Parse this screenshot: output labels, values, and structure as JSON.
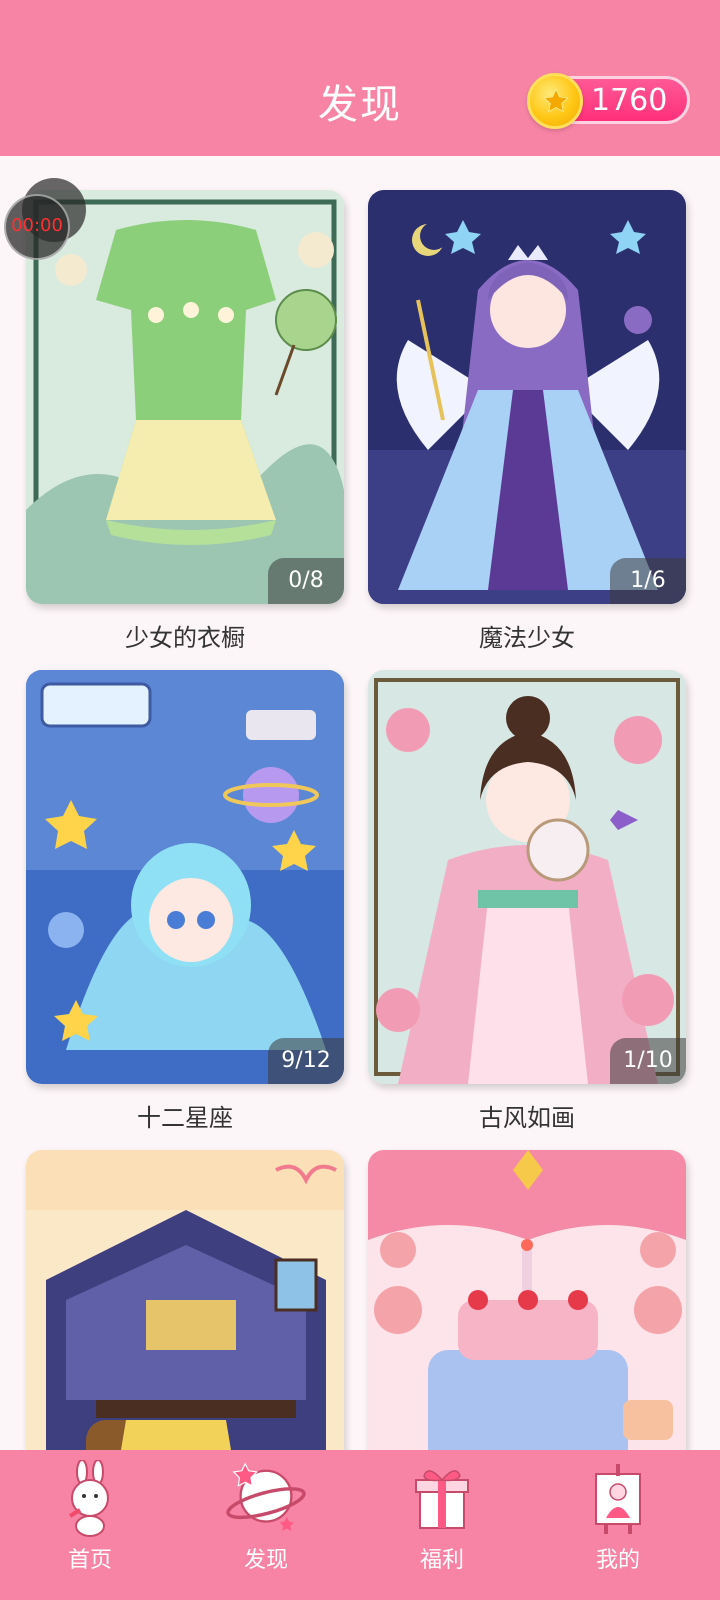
{
  "header": {
    "title": "发现",
    "coins": "1760"
  },
  "timer": {
    "text": "00:00"
  },
  "cards": [
    {
      "label": "少女的衣橱",
      "progress": "0/8"
    },
    {
      "label": "魔法少女",
      "progress": "1/6"
    },
    {
      "label": "十二星座",
      "progress": "9/12"
    },
    {
      "label": "古风如画",
      "progress": "1/10"
    },
    {
      "label": "",
      "progress": ""
    },
    {
      "label": "",
      "progress": ""
    }
  ],
  "tabbar": {
    "items": [
      {
        "label": "首页",
        "icon": "bunny-icon"
      },
      {
        "label": "发现",
        "icon": "planet-icon"
      },
      {
        "label": "福利",
        "icon": "gift-icon"
      },
      {
        "label": "我的",
        "icon": "profile-frame-icon"
      }
    ]
  },
  "colors": {
    "header_bg": "#f784a4",
    "accent": "#ff3d82",
    "coin": "#ffc715"
  }
}
